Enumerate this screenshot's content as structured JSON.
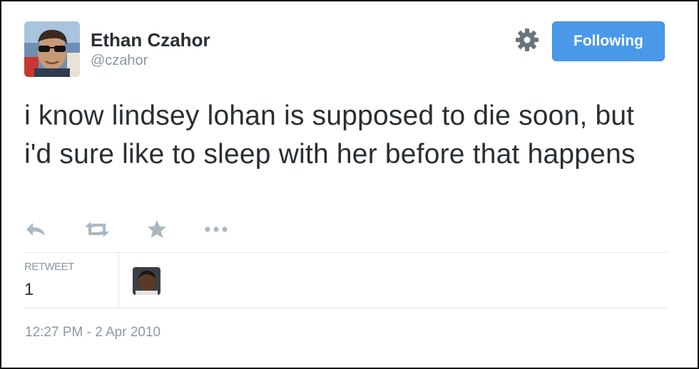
{
  "author": {
    "name": "Ethan Czahor",
    "handle": "@czahor"
  },
  "follow_button": {
    "label": "Following"
  },
  "tweet": {
    "text": "i know lindsey lohan is supposed to die soon, but i'd sure like to sleep with her before that happens"
  },
  "actions": [
    {
      "icon": "reply-icon"
    },
    {
      "icon": "retweet-icon"
    },
    {
      "icon": "favorite-star-icon"
    },
    {
      "icon": "more-dots-icon"
    }
  ],
  "stats": {
    "retweet_label": "RETWEET",
    "retweet_count": "1"
  },
  "timestamp": "12:27 PM - 2 Apr 2010",
  "colors": {
    "follow_button": "#4a99e9",
    "muted_text": "#8899a6",
    "body_text": "#292f33",
    "divider": "#e1e8ed",
    "icon_gray": "#aab8c2"
  }
}
